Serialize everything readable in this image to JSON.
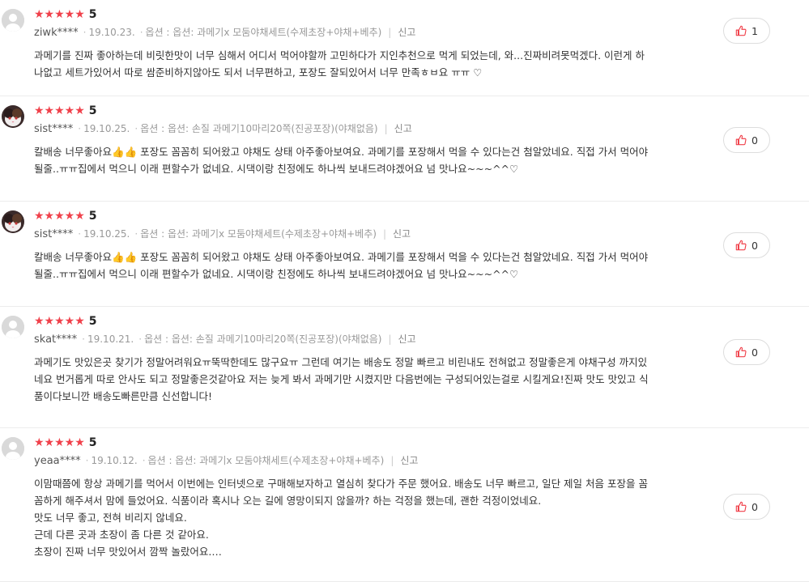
{
  "colors": {
    "star": "#f0414b",
    "accent": "#f0414b"
  },
  "icons": {
    "like": "thumbs-up-icon",
    "star": "star-icon"
  },
  "reviews": [
    {
      "stars": "★★★★★",
      "score": "5",
      "user": "ziwk****",
      "date": "19.10.23.",
      "option": "옵션 : 옵션: 과메기x 모둠야채세트(수제초장+야채+베추)",
      "report": "신고",
      "lines": [
        "과메기를 진짜 좋아하는데 비릿한맛이 너무 심해서 어디서 먹어야할까 고민하다가 지인추천으로 먹게 되었는데, 와...진짜비려못먹겠다. 이런게 하",
        "나없고 세트가있어서 따로 쌈준비하지않아도 되서 너무편하고, 포장도 잘되있어서 너무 만족ㅎㅂ요 ㅠㅠ ♡"
      ],
      "likes": "1",
      "avatar": "gray"
    },
    {
      "stars": "★★★★★",
      "score": "5",
      "user": "sist****",
      "date": "19.10.25.",
      "option": "옵션 : 옵션: 손질 과메기10마리20쪽(진공포장)(야채없음)",
      "report": "신고",
      "lines": [
        "칼배송 너무좋아요👍👍 포장도 꼼꼼히 되어왔고 야채도 상태 아주좋아보여요. 과메기를 포장해서 먹을 수 있다는건 첨알았네요. 직접 가서 먹어야",
        "될줄..ㅠㅠ집에서 먹으니 이래 편할수가 없네요. 시댁이랑 친정에도 하나씩 보내드려야겠어요 넘 맛나요~~~^^♡"
      ],
      "likes": "0",
      "avatar": "cat"
    },
    {
      "stars": "★★★★★",
      "score": "5",
      "user": "sist****",
      "date": "19.10.25.",
      "option": "옵션 : 옵션: 과메기x 모둠야채세트(수제초장+야채+베추)",
      "report": "신고",
      "lines": [
        "칼배송 너무좋아요👍👍 포장도 꼼꼼히 되어왔고 야채도 상태 아주좋아보여요. 과메기를 포장해서 먹을 수 있다는건 첨알았네요. 직접 가서 먹어야",
        "될줄..ㅠㅠ집에서 먹으니 이래 편할수가 없네요. 시댁이랑 친정에도 하나씩 보내드려야겠어요 넘 맛나요~~~^^♡"
      ],
      "likes": "0",
      "avatar": "cat"
    },
    {
      "stars": "★★★★★",
      "score": "5",
      "user": "skat****",
      "date": "19.10.21.",
      "option": "옵션 : 옵션: 손질 과메기10마리20쪽(진공포장)(야채없음)",
      "report": "신고",
      "lines": [
        "과메기도 맛있은곳 찾기가 정말어려워요ㅠ뚝딱한데도 많구요ㅠ 그런데 여기는 배송도 정말 빠르고 비린내도 전혀없고 정말좋은게 야채구성 까지있",
        "네요 번거롭게 따로 안사도 되고 정말좋은것같아요 저는 늦게 봐서 과메기만 시켰지만 다음번에는 구성되어있는걸로 시킬게요!진짜 맛도 맛있고 식",
        "품이다보니깐 배송도빠른만큼 신선합니다!"
      ],
      "likes": "0",
      "avatar": "gray"
    },
    {
      "stars": "★★★★★",
      "score": "5",
      "user": "yeaa****",
      "date": "19.10.12.",
      "option": "옵션 : 옵션: 과메기x 모둠야채세트(수제초장+야채+베추)",
      "report": "신고",
      "lines": [
        "이맘때쯤에 항상 과메기를 먹어서 이번에는 인터넷으로 구매해보자하고 열심히 찾다가 주문 했어요. 배송도 너무 빠르고, 일단 제일 처음 포장을 꼼",
        "꼼하게 해주셔서 맘에 들었어요. 식품이라 혹시나 오는 길에 영망이되지 않을까? 하는 걱정을 했는데, 괜한 걱정이었네요.",
        "맛도 너무 좋고, 전혀 비리지 않네요.",
        "근데 다른 곳과 초장이 좀 다른 것 같아요.",
        "초장이 진짜 너무 맛있어서 깜짝 놀랐어요.…"
      ],
      "likes": "0",
      "avatar": "gray"
    }
  ]
}
